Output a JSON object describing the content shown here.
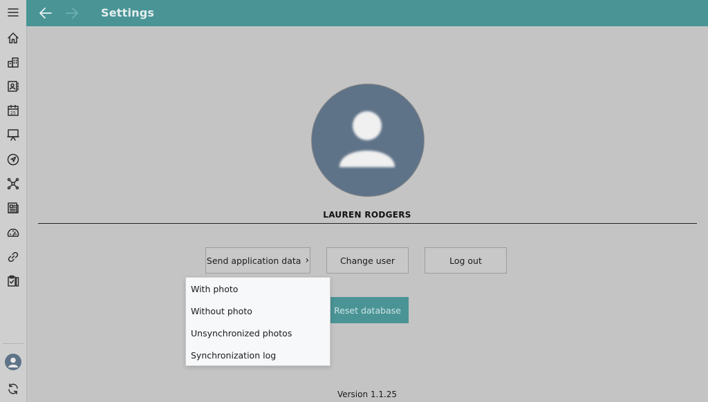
{
  "header": {
    "title": "Settings"
  },
  "profile": {
    "name": "LAUREN RODGERS"
  },
  "actions": {
    "send_label": "Send application data",
    "send_chevron": "›",
    "change_user_label": "Change user",
    "logout_label": "Log out",
    "reset_label": "Reset database"
  },
  "send_menu": {
    "items": [
      "With photo",
      "Without photo",
      "Unsynchronized photos",
      "Synchronization log"
    ]
  },
  "footer": {
    "version": "Version 1.1.25"
  },
  "sidebar": {
    "icons": [
      "hamburger-menu-icon",
      "home-icon",
      "buildings-icon",
      "contacts-icon",
      "calendar-icon",
      "presentation-icon",
      "navigation-icon",
      "network-icon",
      "news-icon",
      "dashboard-gauge-icon",
      "link-icon",
      "clipboard-icon"
    ],
    "calendar_day": "25"
  },
  "colors": {
    "accent": "#4a9496",
    "avatar": "#5f7388",
    "background": "#c4c4c4"
  }
}
